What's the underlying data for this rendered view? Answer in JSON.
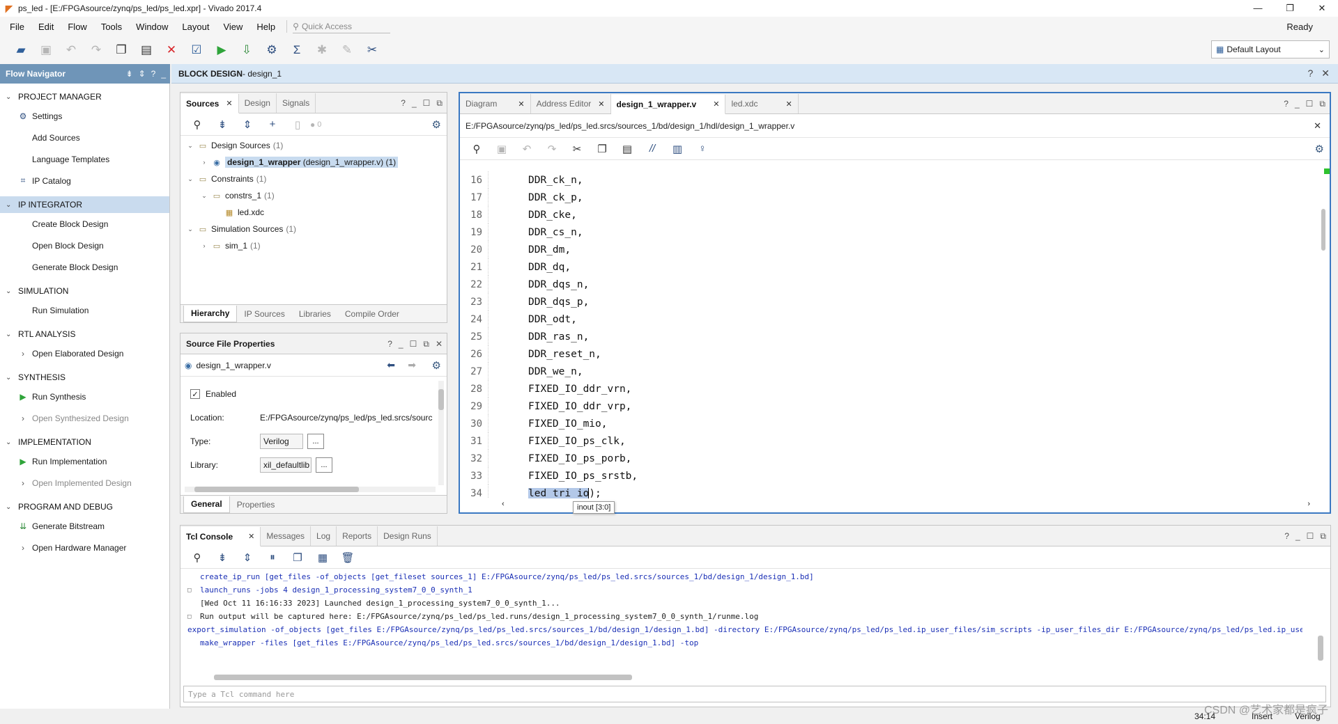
{
  "window": {
    "title": "ps_led - [E:/FPGAsource/zynq/ps_led/ps_led.xpr] - Vivado 2017.4"
  },
  "menu": [
    "File",
    "Edit",
    "Flow",
    "Tools",
    "Window",
    "Layout",
    "View",
    "Help"
  ],
  "quick_access": {
    "placeholder": "Quick Access"
  },
  "status_ready": "Ready",
  "layout_select": {
    "value": "Default Layout"
  },
  "flow_navigator": {
    "title": "Flow Navigator",
    "sections": [
      {
        "title": "PROJECT MANAGER",
        "selected": false,
        "items": [
          {
            "label": "Settings",
            "icon": "gear-icon",
            "dim": false
          },
          {
            "label": "Add Sources",
            "icon": "",
            "dim": false
          },
          {
            "label": "Language Templates",
            "icon": "",
            "dim": false
          },
          {
            "label": "IP Catalog",
            "icon": "ip-icon",
            "dim": false
          }
        ]
      },
      {
        "title": "IP INTEGRATOR",
        "selected": true,
        "items": [
          {
            "label": "Create Block Design",
            "icon": "",
            "dim": false
          },
          {
            "label": "Open Block Design",
            "icon": "",
            "dim": false
          },
          {
            "label": "Generate Block Design",
            "icon": "",
            "dim": false
          }
        ]
      },
      {
        "title": "SIMULATION",
        "selected": false,
        "items": [
          {
            "label": "Run Simulation",
            "icon": "",
            "dim": false
          }
        ]
      },
      {
        "title": "RTL ANALYSIS",
        "selected": false,
        "items": [
          {
            "label": "Open Elaborated Design",
            "icon": "chevron-right-icon",
            "dim": false
          }
        ]
      },
      {
        "title": "SYNTHESIS",
        "selected": false,
        "items": [
          {
            "label": "Run Synthesis",
            "icon": "play-icon",
            "dim": false
          },
          {
            "label": "Open Synthesized Design",
            "icon": "chevron-right-icon",
            "dim": true
          }
        ]
      },
      {
        "title": "IMPLEMENTATION",
        "selected": false,
        "items": [
          {
            "label": "Run Implementation",
            "icon": "play-icon",
            "dim": false
          },
          {
            "label": "Open Implemented Design",
            "icon": "chevron-right-icon",
            "dim": true
          }
        ]
      },
      {
        "title": "PROGRAM AND DEBUG",
        "selected": false,
        "items": [
          {
            "label": "Generate Bitstream",
            "icon": "bitstream-icon",
            "dim": false
          },
          {
            "label": "Open Hardware Manager",
            "icon": "chevron-right-icon",
            "dim": false
          }
        ]
      }
    ]
  },
  "block_design": {
    "title_prefix": "BLOCK DESIGN",
    "title_name": " - design_1"
  },
  "sources": {
    "tabs": [
      "Sources",
      "Design",
      "Signals"
    ],
    "count_badge": "0",
    "tree": {
      "design_sources": {
        "label": "Design Sources",
        "count": "(1)"
      },
      "wrapper": {
        "name": "design_1_wrapper",
        "detail": " (design_1_wrapper.v) (1)"
      },
      "constraints": {
        "label": "Constraints",
        "count": "(1)"
      },
      "constrs": {
        "label": "constrs_1",
        "count": "(1)"
      },
      "xdc": {
        "label": "led.xdc"
      },
      "sim_sources": {
        "label": "Simulation Sources",
        "count": "(1)"
      },
      "sim": {
        "label": "sim_1",
        "count": "(1)"
      }
    },
    "bottom_tabs": [
      "Hierarchy",
      "IP Sources",
      "Libraries",
      "Compile Order"
    ]
  },
  "props": {
    "title": "Source File Properties",
    "file": "design_1_wrapper.v",
    "enabled_label": "Enabled",
    "location_label": "Location:",
    "location_value": "E:/FPGAsource/zynq/ps_led/ps_led.srcs/sourc",
    "type_label": "Type:",
    "type_value": "Verilog",
    "library_label": "Library:",
    "library_value": "xil_defaultlib",
    "dots": "...",
    "bottom_tabs": [
      "General",
      "Properties"
    ]
  },
  "editor": {
    "tabs": [
      "Diagram",
      "Address Editor",
      "design_1_wrapper.v",
      "led.xdc"
    ],
    "path": "E:/FPGAsource/zynq/ps_led/ps_led.srcs/sources_1/bd/design_1/hdl/design_1_wrapper.v",
    "lines": [
      {
        "n": "16",
        "t": "DDR_ck_n,"
      },
      {
        "n": "17",
        "t": "DDR_ck_p,"
      },
      {
        "n": "18",
        "t": "DDR_cke,"
      },
      {
        "n": "19",
        "t": "DDR_cs_n,"
      },
      {
        "n": "20",
        "t": "DDR_dm,"
      },
      {
        "n": "21",
        "t": "DDR_dq,"
      },
      {
        "n": "22",
        "t": "DDR_dqs_n,"
      },
      {
        "n": "23",
        "t": "DDR_dqs_p,"
      },
      {
        "n": "24",
        "t": "DDR_odt,"
      },
      {
        "n": "25",
        "t": "DDR_ras_n,"
      },
      {
        "n": "26",
        "t": "DDR_reset_n,"
      },
      {
        "n": "27",
        "t": "DDR_we_n,"
      },
      {
        "n": "28",
        "t": "FIXED_IO_ddr_vrn,"
      },
      {
        "n": "29",
        "t": "FIXED_IO_ddr_vrp,"
      },
      {
        "n": "30",
        "t": "FIXED_IO_mio,"
      },
      {
        "n": "31",
        "t": "FIXED_IO_ps_clk,"
      },
      {
        "n": "32",
        "t": "FIXED_IO_ps_porb,"
      },
      {
        "n": "33",
        "t": "FIXED_IO_ps_srstb,"
      }
    ],
    "last_line": {
      "n": "34",
      "sel": "led_tri_io",
      "rest": ");"
    },
    "tooltip": "inout [3:0]"
  },
  "console": {
    "tabs": [
      "Tcl Console",
      "Messages",
      "Log",
      "Reports",
      "Design Runs"
    ],
    "lines": [
      {
        "g": "",
        "cls": "blue",
        "t": "create_ip_run [get_files -of_objects [get_fileset sources_1] E:/FPGAsource/zynq/ps_led/ps_led.srcs/sources_1/bd/design_1/design_1.bd]"
      },
      {
        "g": "□",
        "cls": "blue",
        "t": "launch_runs -jobs 4 design_1_processing_system7_0_0_synth_1"
      },
      {
        "g": "",
        "cls": "blk",
        "t": "[Wed Oct 11 16:16:33 2023] Launched design_1_processing_system7_0_0_synth_1..."
      },
      {
        "g": "□",
        "cls": "blk",
        "t": "Run output will be captured here: E:/FPGAsource/zynq/ps_led/ps_led.runs/design_1_processing_system7_0_0_synth_1/runme.log"
      },
      {
        "g": "",
        "cls": "blue",
        "t": "export_simulation -of_objects [get_files E:/FPGAsource/zynq/ps_led/ps_led.srcs/sources_1/bd/design_1/design_1.bd] -directory E:/FPGAsource/zynq/ps_led/ps_led.ip_user_files/sim_scripts -ip_user_files_dir E:/FPGAsource/zynq/ps_led/ps_led.ip_user_files -ipstatic_sourc"
      },
      {
        "g": "",
        "cls": "blue",
        "t": "make_wrapper -files [get_files E:/FPGAsource/zynq/ps_led/ps_led.srcs/sources_1/bd/design_1/design_1.bd] -top"
      }
    ],
    "input_placeholder": "Type a Tcl command here"
  },
  "statusbar": {
    "position": "34:14",
    "mode": "Insert",
    "lang": "Verilog"
  },
  "watermark": "CSDN @艺术家都是疯子",
  "colors": {
    "accent": "#3a78c2",
    "nav_header": "#6f95b8",
    "selection": "#c9dbee"
  }
}
